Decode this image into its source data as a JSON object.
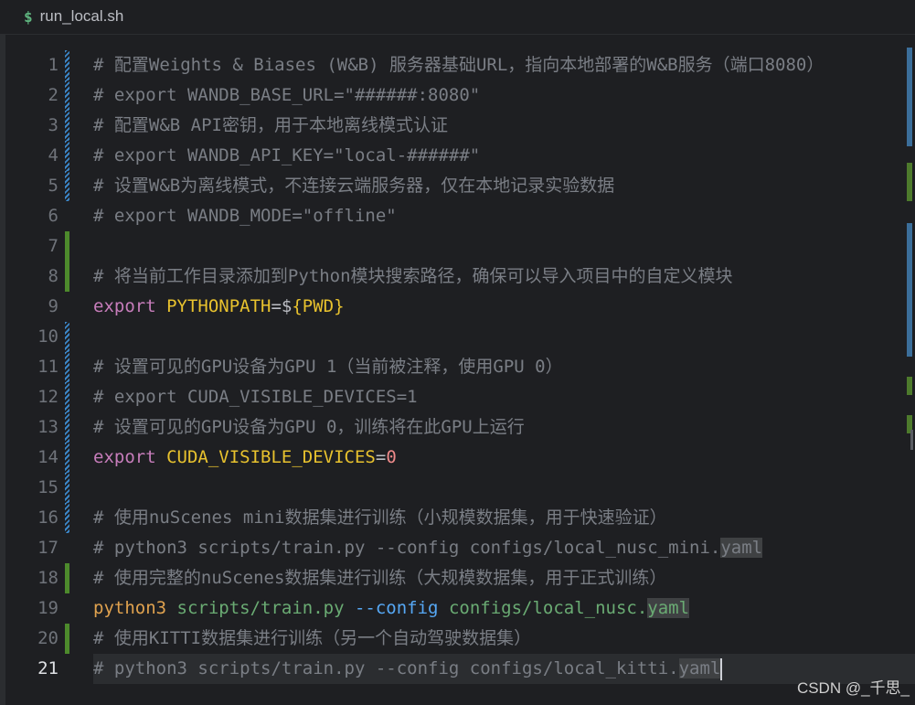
{
  "tab": {
    "icon": "$",
    "filename": "run_local.sh"
  },
  "lines": [
    {
      "n": "1",
      "gutter": "mod",
      "parts": [
        {
          "c": "com",
          "t": "# 配置Weights & Biases (W&B) 服务器基础URL，指向本地部署的W&B服务（端口8080）"
        }
      ]
    },
    {
      "n": "2",
      "gutter": "mod",
      "parts": [
        {
          "c": "com",
          "t": "# export WANDB_BASE_URL=\"######:8080\""
        }
      ]
    },
    {
      "n": "3",
      "gutter": "mod",
      "parts": [
        {
          "c": "com",
          "t": "# 配置W&B API密钥，用于本地离线模式认证"
        }
      ]
    },
    {
      "n": "4",
      "gutter": "mod",
      "parts": [
        {
          "c": "com",
          "t": "# export WANDB_API_KEY=\"local-######\""
        }
      ]
    },
    {
      "n": "5",
      "gutter": "mod",
      "parts": [
        {
          "c": "com",
          "t": "# 设置W&B为离线模式，不连接云端服务器，仅在本地记录实验数据"
        }
      ]
    },
    {
      "n": "6",
      "gutter": "",
      "parts": [
        {
          "c": "com",
          "t": "# export WANDB_MODE=\"offline\""
        }
      ]
    },
    {
      "n": "7",
      "gutter": "add",
      "parts": []
    },
    {
      "n": "8",
      "gutter": "add",
      "parts": [
        {
          "c": "com",
          "t": "# 将当前工作目录添加到Python模块搜索路径，确保可以导入项目中的自定义模块"
        }
      ]
    },
    {
      "n": "9",
      "gutter": "",
      "parts": [
        {
          "c": "kw",
          "t": "export "
        },
        {
          "c": "var",
          "t": "PYTHONPATH"
        },
        {
          "c": "op",
          "t": "=$"
        },
        {
          "c": "brace",
          "t": "{PWD}"
        }
      ]
    },
    {
      "n": "10",
      "gutter": "mod",
      "parts": []
    },
    {
      "n": "11",
      "gutter": "mod",
      "parts": [
        {
          "c": "com",
          "t": "# 设置可见的GPU设备为GPU 1（当前被注释，使用GPU 0）"
        }
      ]
    },
    {
      "n": "12",
      "gutter": "mod",
      "parts": [
        {
          "c": "com",
          "t": "# export CUDA_VISIBLE_DEVICES=1"
        }
      ]
    },
    {
      "n": "13",
      "gutter": "mod",
      "parts": [
        {
          "c": "com",
          "t": "# 设置可见的GPU设备为GPU 0，训练将在此GPU上运行"
        }
      ]
    },
    {
      "n": "14",
      "gutter": "mod",
      "parts": [
        {
          "c": "kw",
          "t": "export "
        },
        {
          "c": "var",
          "t": "CUDA_VISIBLE_DEVICES"
        },
        {
          "c": "op",
          "t": "="
        },
        {
          "c": "num",
          "t": "0"
        }
      ]
    },
    {
      "n": "15",
      "gutter": "mod",
      "parts": []
    },
    {
      "n": "16",
      "gutter": "mod",
      "parts": [
        {
          "c": "com",
          "t": "# 使用nuScenes mini数据集进行训练（小规模数据集，用于快速验证）"
        }
      ]
    },
    {
      "n": "17",
      "gutter": "",
      "parts": [
        {
          "c": "com",
          "t": "# python3 scripts/train.py --config configs/local_nusc_mini."
        },
        {
          "c": "com sel",
          "t": "yaml"
        }
      ]
    },
    {
      "n": "18",
      "gutter": "add",
      "parts": [
        {
          "c": "com",
          "t": "# 使用完整的nuScenes数据集进行训练（大规模数据集，用于正式训练）"
        }
      ]
    },
    {
      "n": "19",
      "gutter": "",
      "parts": [
        {
          "c": "bin",
          "t": "python3 "
        },
        {
          "c": "path",
          "t": "scripts/train.py "
        },
        {
          "c": "flag",
          "t": "--config "
        },
        {
          "c": "path",
          "t": "configs/local_nusc."
        },
        {
          "c": "path sel",
          "t": "yaml"
        }
      ]
    },
    {
      "n": "20",
      "gutter": "add",
      "parts": [
        {
          "c": "com",
          "t": "# 使用KITTI数据集进行训练（另一个自动驾驶数据集）"
        }
      ]
    },
    {
      "n": "21",
      "gutter": "",
      "current": true,
      "parts": [
        {
          "c": "com",
          "t": "# python3 scripts/train.py --config configs/local_kitti."
        },
        {
          "c": "com sel",
          "t": "yaml"
        }
      ],
      "caret": true
    }
  ],
  "watermark": "CSDN @_千思_",
  "colors": {
    "modified": "#3b86c8",
    "added": "#4d8a2c",
    "background": "#1e1f22"
  }
}
